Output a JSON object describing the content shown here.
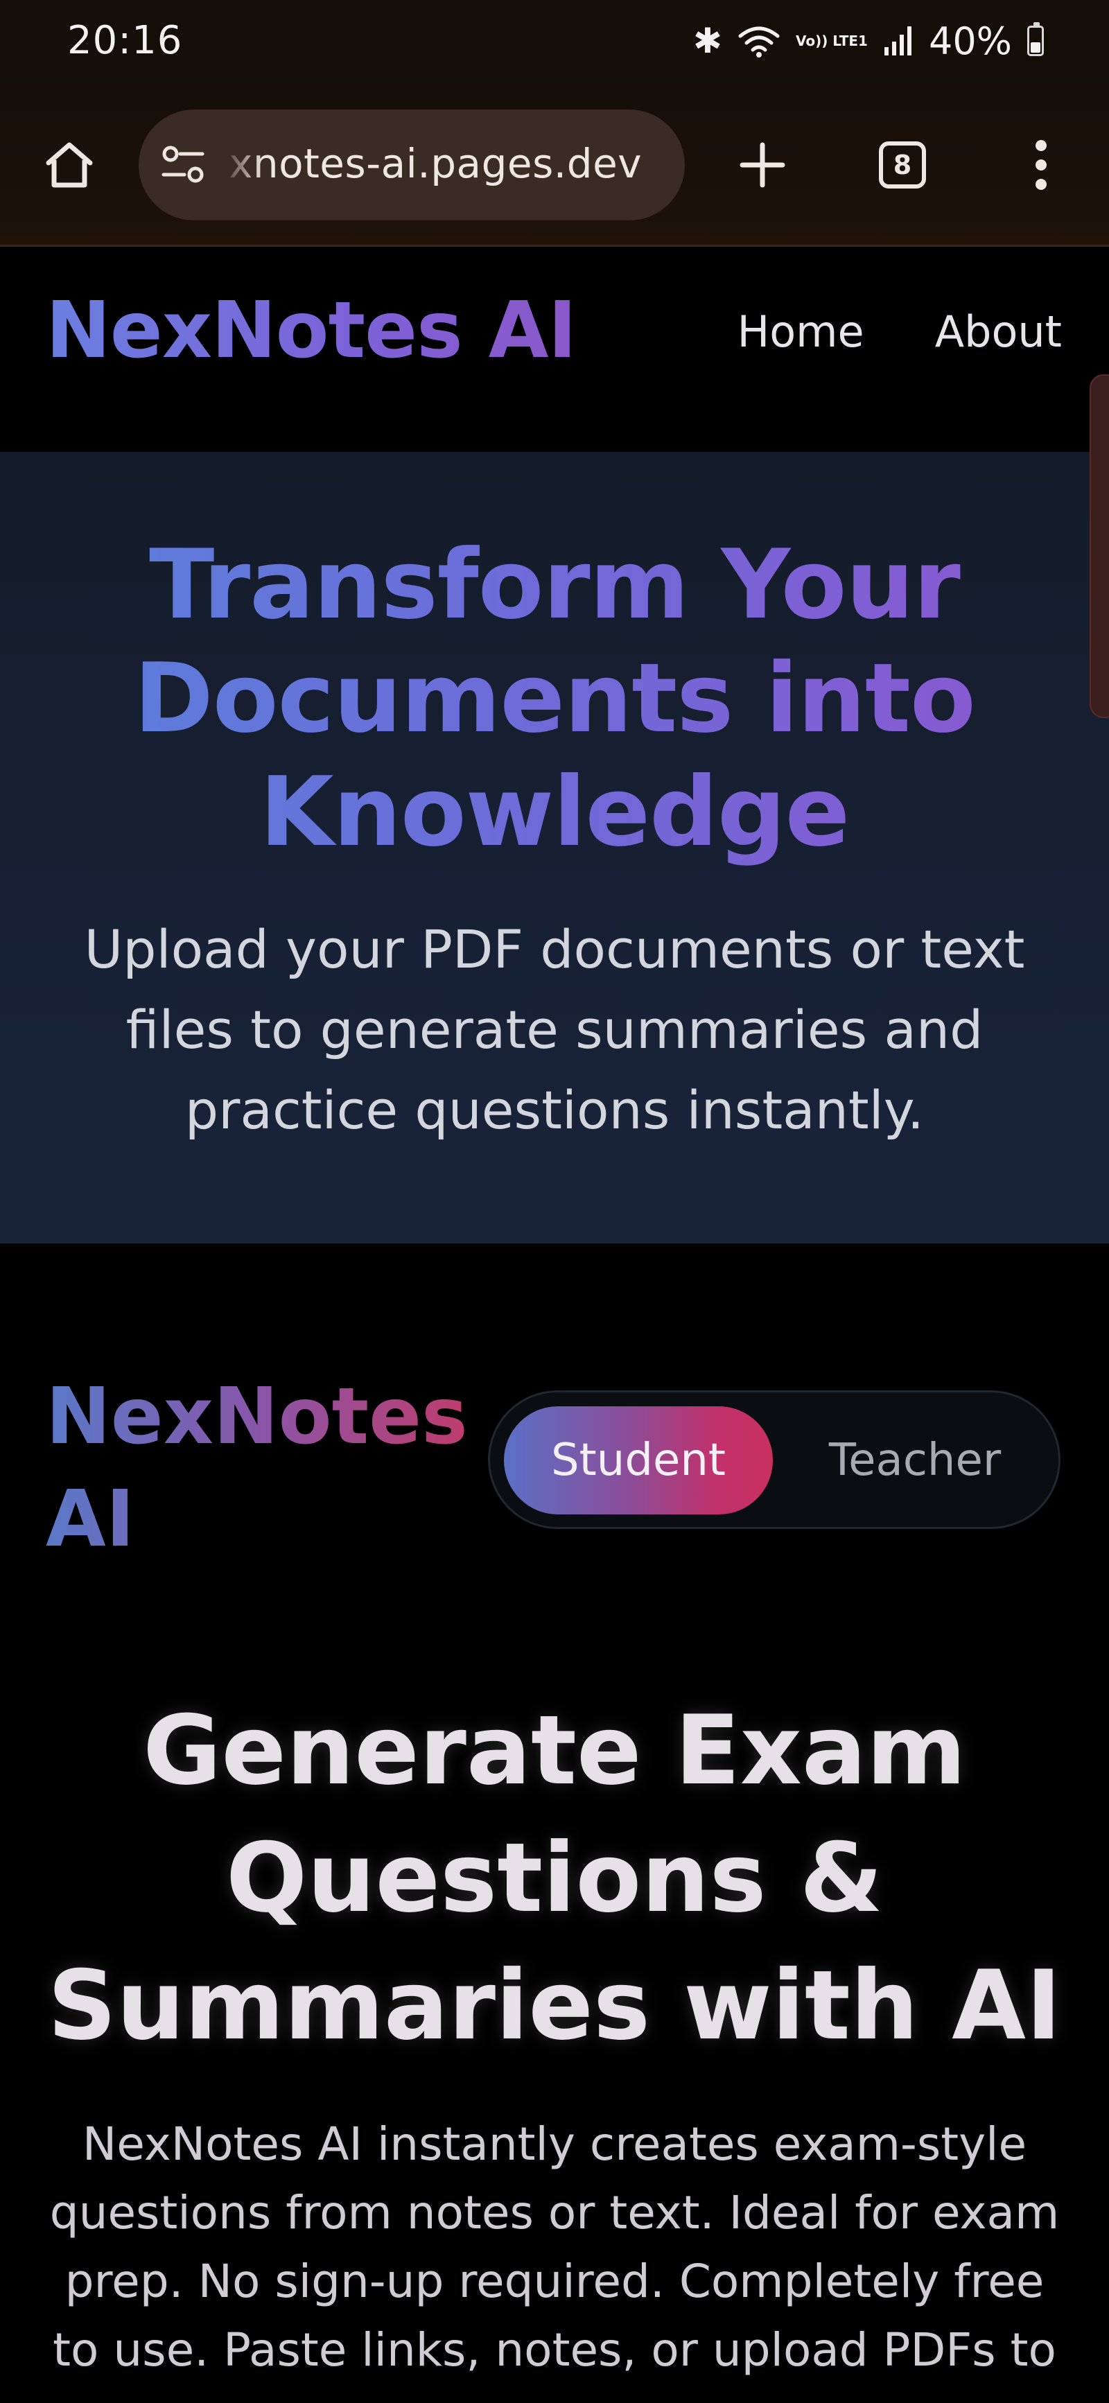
{
  "status_bar": {
    "time": "20:16",
    "network_label": "Vo)) LTE1",
    "battery": "40%",
    "battery_level": 0.4
  },
  "browser": {
    "url": "xnotes-ai.pages.dev",
    "tab_count": "8",
    "icons": {
      "home": "home-icon",
      "site_settings": "tune-icon",
      "new_tab": "plus-icon",
      "menu": "more-vert-icon"
    }
  },
  "nav": {
    "brand": "NexNotes AI",
    "links": [
      "Home",
      "About"
    ]
  },
  "hero": {
    "title": "Transform Your Documents into Knowledge",
    "subtitle": "Upload your PDF documents or text files to generate summaries and practice questions instantly."
  },
  "role_section": {
    "brand": "NexNotes AI",
    "roles": [
      "Student",
      "Teacher"
    ],
    "selected_role": "Student",
    "title": "Generate Exam Questions & Summaries with AI",
    "description": "NexNotes AI instantly creates exam-style questions from notes or text. Ideal for exam prep. No sign-up required. Completely free to use. Paste links, notes, or upload PDFs to"
  },
  "colors": {
    "brand_gradient_start": "#6a7fe0",
    "brand_gradient_end": "#8a57c9",
    "student_gradient_start": "#5b70c6",
    "student_gradient_end": "#c8305e",
    "hero_bg": "#172033",
    "page_bg": "#000000"
  }
}
